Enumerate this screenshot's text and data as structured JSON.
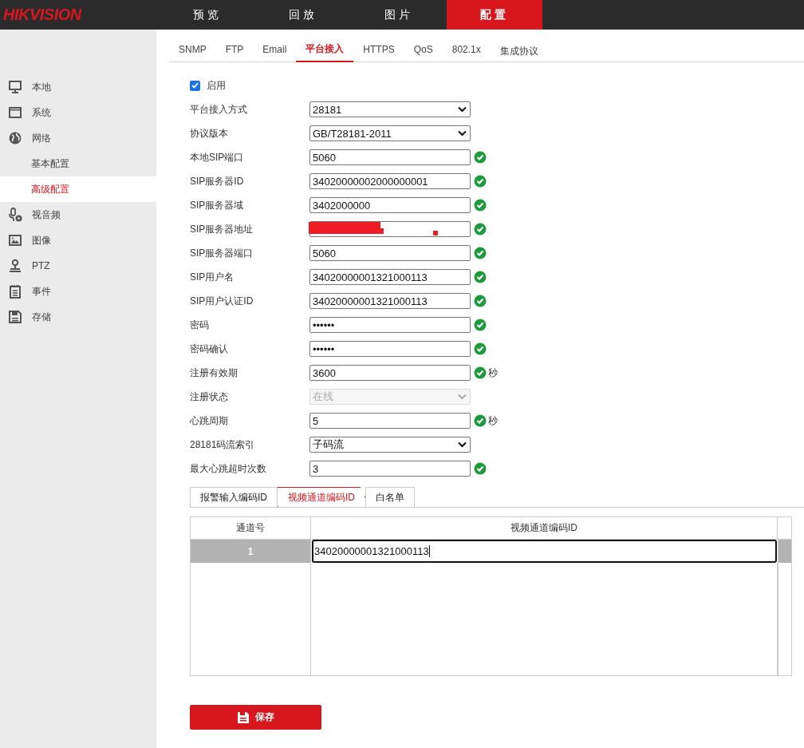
{
  "header": {
    "logo": "HIKVISION",
    "nav": [
      {
        "label": "预览",
        "selected": false
      },
      {
        "label": "回放",
        "selected": false
      },
      {
        "label": "图片",
        "selected": false
      },
      {
        "label": "配置",
        "selected": true
      }
    ]
  },
  "sidebar": {
    "items": [
      {
        "label": "本地",
        "selected": false
      },
      {
        "label": "系统",
        "selected": false
      },
      {
        "label": "网络",
        "selected": false,
        "children": [
          {
            "label": "基本配置",
            "selected": false
          },
          {
            "label": "高级配置",
            "selected": true
          }
        ]
      },
      {
        "label": "视音频",
        "selected": false
      },
      {
        "label": "图像",
        "selected": false
      },
      {
        "label": "PTZ",
        "selected": false
      },
      {
        "label": "事件",
        "selected": false
      },
      {
        "label": "存储",
        "selected": false
      }
    ]
  },
  "tabs": [
    {
      "label": "SNMP",
      "selected": false
    },
    {
      "label": "FTP",
      "selected": false
    },
    {
      "label": "Email",
      "selected": false
    },
    {
      "label": "平台接入",
      "selected": true
    },
    {
      "label": "HTTPS",
      "selected": false
    },
    {
      "label": "QoS",
      "selected": false
    },
    {
      "label": "802.1x",
      "selected": false
    },
    {
      "label": "集成协议",
      "selected": false
    }
  ],
  "enable": {
    "label": "启用",
    "checked": true
  },
  "fields": [
    {
      "label": "平台接入方式",
      "kind": "select",
      "value": "28181",
      "valid": false,
      "disabled": false
    },
    {
      "label": "协议版本",
      "kind": "select",
      "value": "GB/T28181-2011",
      "valid": false,
      "disabled": false
    },
    {
      "label": "本地SIP端口",
      "kind": "input",
      "value": "5060",
      "valid": true,
      "disabled": false
    },
    {
      "label": "SIP服务器ID",
      "kind": "input",
      "value": "34020000002000000001",
      "valid": true,
      "disabled": false
    },
    {
      "label": "SIP服务器域",
      "kind": "input",
      "value": "3402000000",
      "valid": true,
      "disabled": false
    },
    {
      "label": "SIP服务器地址",
      "kind": "redacted",
      "valid": true,
      "disabled": false
    },
    {
      "label": "SIP服务器端口",
      "kind": "input",
      "value": "5060",
      "valid": true,
      "disabled": false
    },
    {
      "label": "SIP用户名",
      "kind": "input",
      "value": "34020000001321000113",
      "valid": true,
      "disabled": false
    },
    {
      "label": "SIP用户认证ID",
      "kind": "input",
      "value": "34020000001321000113",
      "valid": true,
      "disabled": false
    },
    {
      "label": "密码",
      "kind": "input",
      "value": "••••••",
      "valid": true,
      "disabled": false
    },
    {
      "label": "密码确认",
      "kind": "input",
      "value": "••••••",
      "valid": true,
      "disabled": false
    },
    {
      "label": "注册有效期",
      "kind": "input",
      "value": "3600",
      "valid": true,
      "unit": "秒",
      "disabled": false
    },
    {
      "label": "注册状态",
      "kind": "select",
      "value": "在线",
      "valid": false,
      "disabled": true
    },
    {
      "label": "心跳周期",
      "kind": "input",
      "value": "5",
      "valid": true,
      "unit": "秒",
      "disabled": false
    },
    {
      "label": "28181码流索引",
      "kind": "select",
      "value": "子码流",
      "valid": false,
      "disabled": false
    },
    {
      "label": "最大心跳超时次数",
      "kind": "input",
      "value": "3",
      "valid": true,
      "disabled": false
    }
  ],
  "subtabs": [
    {
      "label": "报警输入编码ID",
      "selected": false
    },
    {
      "label": "视频通道编码ID",
      "selected": true
    },
    {
      "label": "白名单",
      "selected": false
    }
  ],
  "table": {
    "columns": [
      "通道号",
      "视频通道编码ID"
    ],
    "rows": [
      {
        "channel": "1",
        "id": "34020000001321000113",
        "selected": true
      }
    ]
  },
  "save_button": {
    "label": "保存"
  }
}
